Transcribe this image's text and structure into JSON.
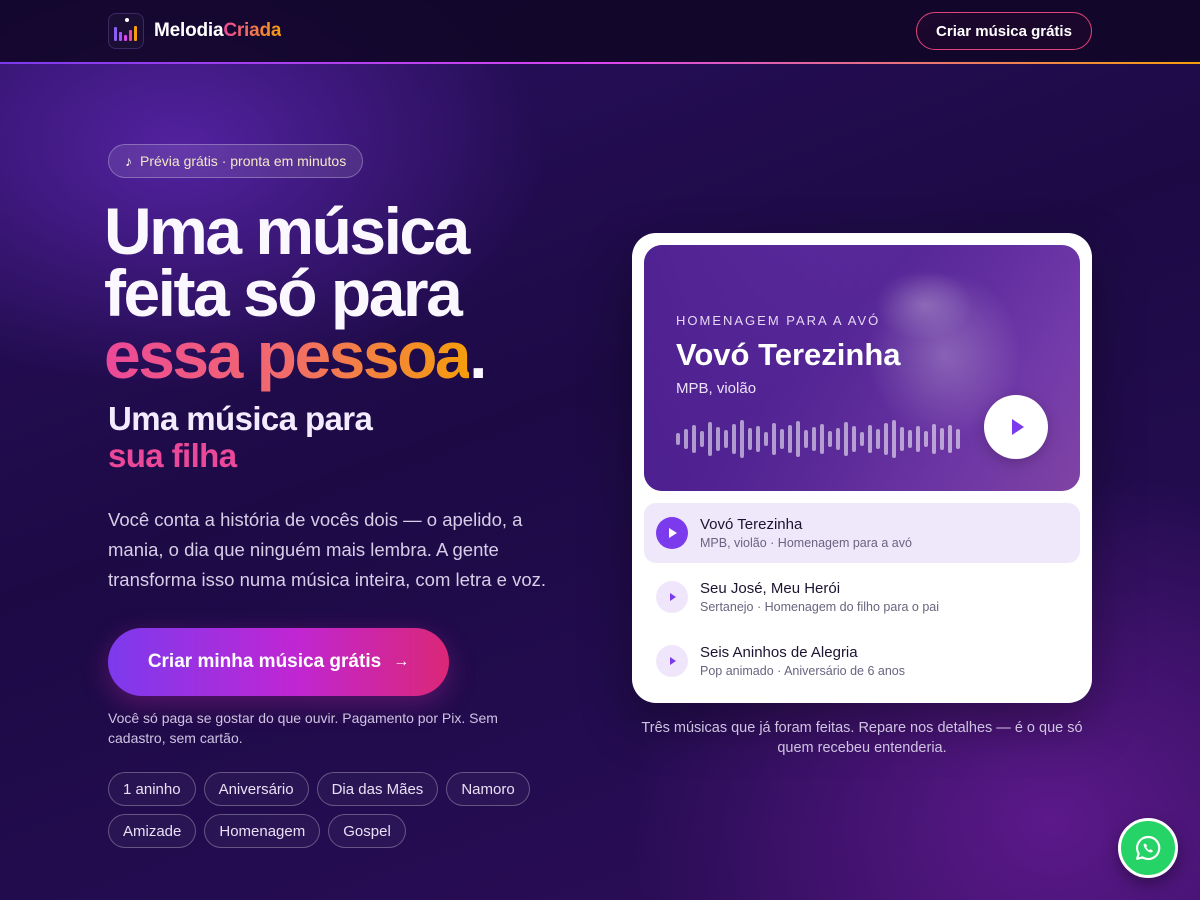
{
  "header": {
    "brand_part1": "Melodia",
    "brand_part2": "Criada",
    "logo_icon": "equalizer-icon",
    "cta_label": "Criar música grátis"
  },
  "hero": {
    "badge": {
      "icon": "music-note-icon",
      "note_glyph": "♪",
      "text": "Prévia grátis · pronta em minutos"
    },
    "headline_line1": "Uma música",
    "headline_line2": "feita só para",
    "headline_highlight": "essa pessoa",
    "headline_period": ".",
    "subheadline_line1": "Uma música para",
    "subheadline_line2": "sua filha",
    "description": "Você conta a história de vocês dois — o apelido, a mania, o dia que ninguém mais lembra. A gente transforma isso numa música inteira, com letra e voz.",
    "cta_label": "Criar minha música grátis",
    "cta_arrow": "→",
    "payment_note": "Você só paga se gostar do que ouvir. Pagamento por Pix. Sem cadastro, sem cartão.",
    "tags": [
      "1 aninho",
      "Aniversário",
      "Dia das Mães",
      "Namoro",
      "Amizade",
      "Homenagem",
      "Gospel"
    ]
  },
  "player": {
    "featured": {
      "eyebrow": "HOMENAGEM PARA A AVÓ",
      "title": "Vovó Terezinha",
      "meta": "MPB, violão"
    },
    "tracks": [
      {
        "title": "Vovó Terezinha",
        "meta": "MPB, violão · Homenagem para a avó",
        "active": true
      },
      {
        "title": "Seu José, Meu Herói",
        "meta": "Sertanejo · Homenagem do filho para o pai",
        "active": false
      },
      {
        "title": "Seis Aninhos de Alegria",
        "meta": "Pop animado · Aniversário de 6 anos",
        "active": false
      }
    ],
    "caption": "Três músicas que já foram feitas. Repare nos detalhes — é o que só quem recebeu entenderia."
  },
  "floating": {
    "icon": "whatsapp-icon"
  },
  "colors": {
    "accent_purple": "#7c3aed",
    "accent_pink": "#ec4899",
    "accent_orange": "#f59e0b",
    "whatsapp_green": "#25d366"
  }
}
